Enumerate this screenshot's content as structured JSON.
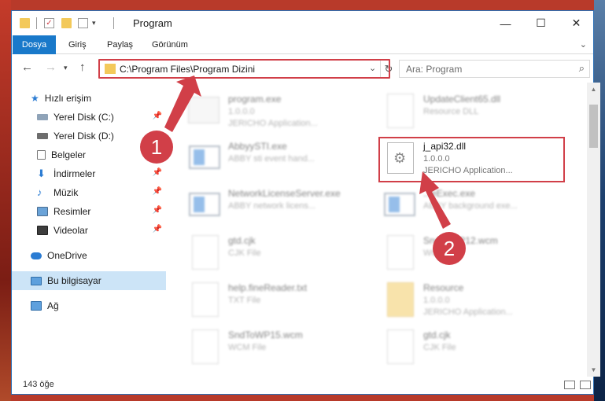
{
  "window": {
    "title": "Program"
  },
  "ribbon": {
    "tabs": [
      "Dosya",
      "Giriş",
      "Paylaş",
      "Görünüm"
    ]
  },
  "address": {
    "path": "C:\\Program Files\\Program Dizini"
  },
  "search": {
    "placeholder": "Ara: Program"
  },
  "nav": {
    "items": [
      {
        "label": "Hızlı erişim",
        "icon": "star-icon",
        "pinned": false
      },
      {
        "label": "Yerel Disk (C:)",
        "icon": "drive-icon",
        "pinned": true
      },
      {
        "label": "Yerel Disk (D:)",
        "icon": "drive-icon",
        "pinned": false
      },
      {
        "label": "Belgeler",
        "icon": "documents-icon",
        "pinned": true
      },
      {
        "label": "İndirmeler",
        "icon": "download-icon",
        "pinned": true
      },
      {
        "label": "Müzik",
        "icon": "music-icon",
        "pinned": true
      },
      {
        "label": "Resimler",
        "icon": "pictures-icon",
        "pinned": true
      },
      {
        "label": "Videolar",
        "icon": "video-icon",
        "pinned": true
      },
      {
        "label": "OneDrive",
        "icon": "cloud-icon",
        "pinned": false
      },
      {
        "label": "Bu bilgisayar",
        "icon": "computer-icon",
        "pinned": false,
        "selected": true
      },
      {
        "label": "Ağ",
        "icon": "network-icon",
        "pinned": false
      }
    ]
  },
  "files": [
    {
      "name": "program.exe",
      "line2": "1.0.0.0",
      "line3": "JERICHO Application...",
      "icon": "exe-icon",
      "blurred": true
    },
    {
      "name": "UpdateClient65.dll",
      "line2": "Resource DLL",
      "line3": "",
      "icon": "dll-icon",
      "blurred": true
    },
    {
      "name": "AbbyySTI.exe",
      "line2": "ABBY sti event hand...",
      "line3": "",
      "icon": "app-icon",
      "blurred": true
    },
    {
      "name": "j_api32.dll",
      "line2": "1.0.0.0",
      "line3": "JERICHO Application...",
      "icon": "dll-icon",
      "blurred": false
    },
    {
      "name": "NetworkLicenseServer.exe",
      "line2": "ABBY network licens...",
      "line3": "",
      "icon": "app-icon",
      "blurred": true
    },
    {
      "name": "...eExec.exe",
      "line2": "ABBY background exe...",
      "line3": "",
      "icon": "app-icon",
      "blurred": true
    },
    {
      "name": "gtd.cjk",
      "line2": "CJK File",
      "line3": "",
      "icon": "doc-icon",
      "blurred": true
    },
    {
      "name": "SndToWP12.wcm",
      "line2": "WCM File",
      "line3": "",
      "icon": "doc-icon",
      "blurred": true
    },
    {
      "name": "help.fineReader.txt",
      "line2": "TXT File",
      "line3": "",
      "icon": "doc-icon",
      "blurred": true
    },
    {
      "name": "Resource",
      "line2": "1.0.0.0",
      "line3": "JERICHO Application...",
      "icon": "folder-icon",
      "blurred": true
    },
    {
      "name": "SndToWP15.wcm",
      "line2": "WCM File",
      "line3": "",
      "icon": "doc-icon",
      "blurred": true
    },
    {
      "name": "gtd.cjk",
      "line2": "CJK File",
      "line3": "",
      "icon": "doc-icon",
      "blurred": true
    }
  ],
  "status": {
    "count": "143 öğe"
  },
  "markers": {
    "one": "1",
    "two": "2"
  },
  "colors": {
    "accent": "#1979ca",
    "highlight": "#d13f48",
    "selected": "#cce4f7"
  }
}
